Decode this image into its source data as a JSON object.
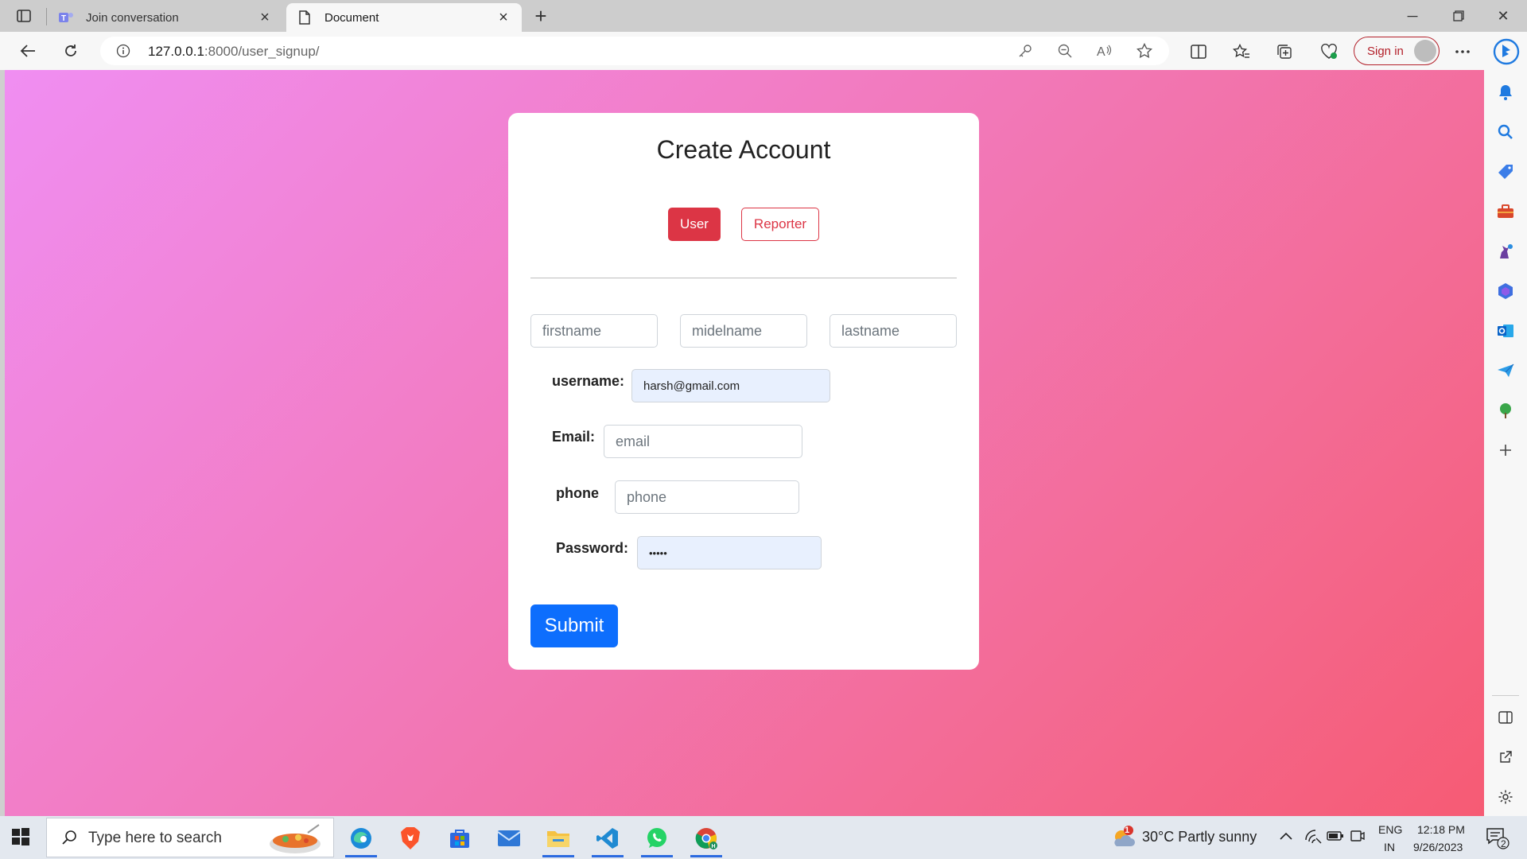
{
  "browser": {
    "tabs": [
      {
        "title": "Join conversation",
        "active": false
      },
      {
        "title": "Document",
        "active": true
      }
    ],
    "url_host": "127.0.0.1",
    "url_rest": ":8000/user_signup/",
    "signin_label": "Sign in"
  },
  "page": {
    "title": "Create Account",
    "toggle_user": "User",
    "toggle_reporter": "Reporter",
    "fields": {
      "firstname_placeholder": "firstname",
      "midelname_placeholder": "midelname",
      "lastname_placeholder": "lastname",
      "username_label": "username:",
      "username_value": "harsh@gmail.com",
      "email_label": "Email:",
      "email_placeholder": "email",
      "phone_label": "phone",
      "phone_placeholder": "phone",
      "password_label": "Password:",
      "password_value": "•••••"
    },
    "submit_label": "Submit",
    "colors": {
      "gradient_start": "#f08ef2",
      "gradient_end": "#f65b74",
      "user_button": "#dc3545",
      "submit_button": "#0d6efd",
      "autofill_bg": "#e8f0fe"
    }
  },
  "taskbar": {
    "search_placeholder": "Type here to search",
    "weather": "30°C  Partly sunny",
    "weather_badge": "1",
    "lang_top": "ENG",
    "lang_bottom": "IN",
    "time": "12:18 PM",
    "date": "9/26/2023",
    "notification_count": "2"
  }
}
